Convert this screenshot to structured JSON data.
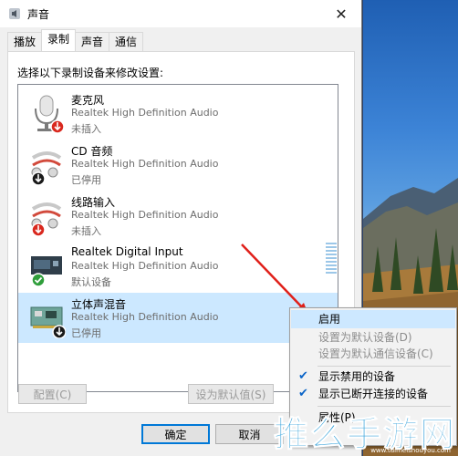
{
  "window": {
    "title": "声音",
    "close_glyph": "✕"
  },
  "tabs": [
    {
      "label": "播放",
      "active": false
    },
    {
      "label": "录制",
      "active": true
    },
    {
      "label": "声音",
      "active": false
    },
    {
      "label": "通信",
      "active": false
    }
  ],
  "instruction": "选择以下录制设备来修改设置:",
  "devices": [
    {
      "name": "麦克风",
      "driver": "Realtek High Definition Audio",
      "status": "未插入",
      "icon": "microphone-icon",
      "badge": "unplugged-badge",
      "selected": false
    },
    {
      "name": "CD 音频",
      "driver": "Realtek High Definition Audio",
      "status": "已停用",
      "icon": "audio-cable-icon",
      "badge": "disabled-badge",
      "selected": false
    },
    {
      "name": "线路输入",
      "driver": "Realtek High Definition Audio",
      "status": "未插入",
      "icon": "audio-cable-icon",
      "badge": "unplugged-badge",
      "selected": false
    },
    {
      "name": "Realtek Digital Input",
      "driver": "Realtek High Definition Audio",
      "status": "默认设备",
      "icon": "digital-input-icon",
      "badge": "default-check-badge",
      "selected": false
    },
    {
      "name": "立体声混音",
      "driver": "Realtek High Definition Audio",
      "status": "已停用",
      "icon": "sound-card-icon",
      "badge": "disabled-badge",
      "selected": true
    }
  ],
  "buttons": {
    "configure": "配置(C)",
    "set_default": "设为默认值(S)",
    "ok": "确定",
    "cancel": "取消"
  },
  "context_menu": [
    {
      "label": "启用",
      "state": "highlighted"
    },
    {
      "label": "设置为默认设备(D)",
      "state": "disabled"
    },
    {
      "label": "设置为默认通信设备(C)",
      "state": "disabled"
    },
    {
      "label": "显示禁用的设备",
      "state": "checked"
    },
    {
      "label": "显示已断开连接的设备",
      "state": "checked"
    },
    {
      "label": "属性(P)",
      "state": "normal"
    }
  ],
  "watermark": {
    "text": "推么手游网",
    "url": "www.tuimeishouyou.com"
  },
  "colors": {
    "accent": "#0078d7",
    "selection": "#cce8ff",
    "arrow": "#e0201a",
    "badge_red": "#d9281e",
    "badge_green": "#2f9e3b"
  }
}
